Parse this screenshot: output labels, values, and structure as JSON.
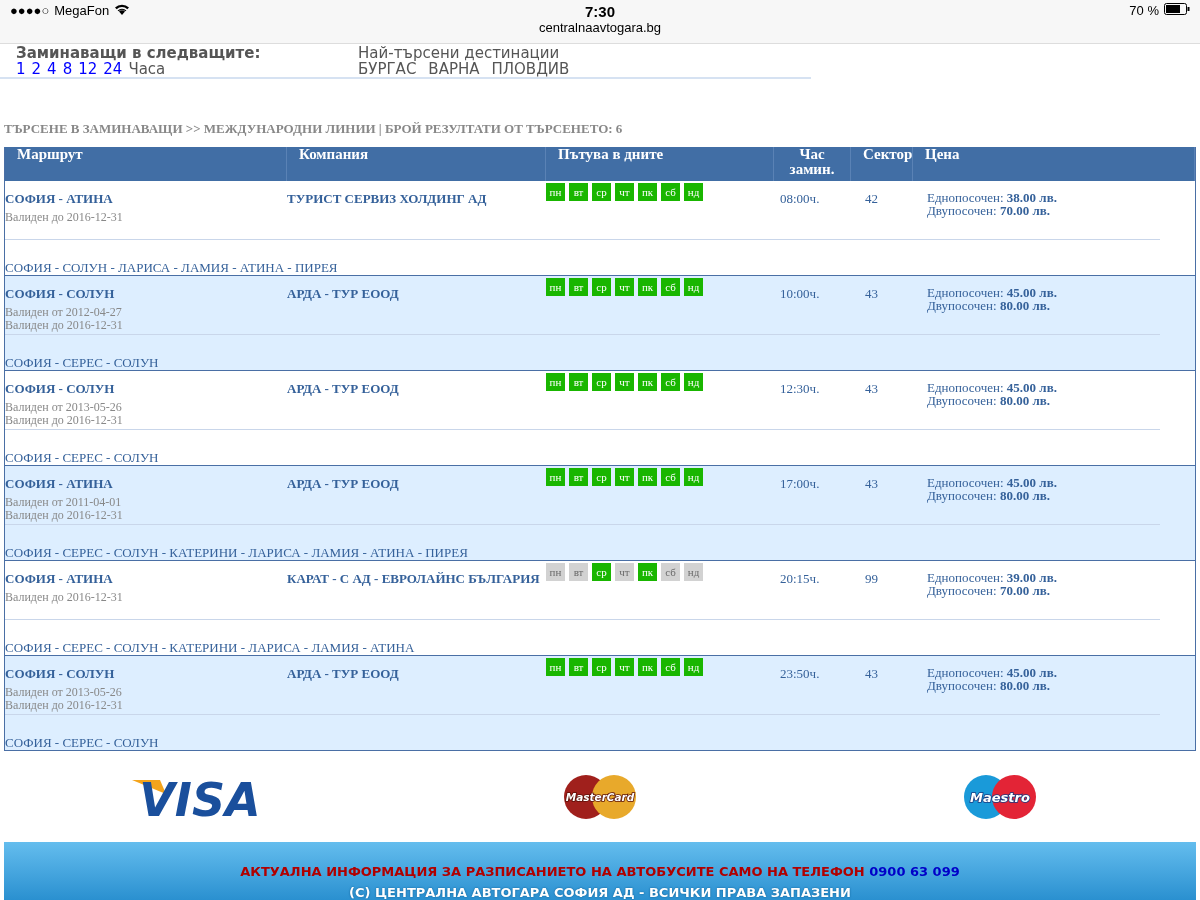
{
  "status_bar": {
    "signal": "●●●●○",
    "carrier": "MegaFon",
    "time": "7:30",
    "url": "centralnaavtogara.bg",
    "battery": "70 %"
  },
  "departures": {
    "label": "Заминаващи в следващите:",
    "hours": [
      "1",
      "2",
      "4",
      "8",
      "12",
      "24"
    ],
    "unit": "Часа"
  },
  "popular": {
    "label": "Най-търсени дестинации",
    "items": [
      "БУРГАС",
      "ВАРНА",
      "ПЛОВДИВ"
    ]
  },
  "results_title": "ТЪРСЕНЕ В ЗАМИНАВАЩИ >> МЕЖДУНАРОДНИ ЛИНИИ | БРОЙ РЕЗУЛТАТИ ОТ ТЪРСЕНЕТО: 6",
  "table": {
    "columns": [
      "Маршрут",
      "Компания",
      "Пътува в дните",
      "Час замин.",
      "Сектор",
      "Цена"
    ],
    "rows": [
      {
        "route": "СОФИЯ - АТИНА",
        "validity": [
          "Валиден до 2016-12-31"
        ],
        "company": "ТУРИСТ СЕРВИЗ ХОЛДИНГ АД",
        "days": [
          {
            "label": "пн",
            "on": true
          },
          {
            "label": "вт",
            "on": true
          },
          {
            "label": "ср",
            "on": true
          },
          {
            "label": "чт",
            "on": true
          },
          {
            "label": "пк",
            "on": true
          },
          {
            "label": "сб",
            "on": true
          },
          {
            "label": "нд",
            "on": true
          }
        ],
        "time": "08:00ч.",
        "sector": "42",
        "one_way_label": "Еднопосочен:",
        "one_way": "38.00 лв.",
        "return_label": "Двупосочен:",
        "return": "70.00 лв.",
        "stops": "СОФИЯ - СОЛУН - ЛАРИСА - ЛАМИЯ - АТИНА - ПИРЕЯ"
      },
      {
        "route": "СОФИЯ - СОЛУН",
        "validity": [
          "Валиден от 2012-04-27",
          "Валиден до 2016-12-31"
        ],
        "company": "АРДА - ТУР ЕООД",
        "days": [
          {
            "label": "пн",
            "on": true
          },
          {
            "label": "вт",
            "on": true
          },
          {
            "label": "ср",
            "on": true
          },
          {
            "label": "чт",
            "on": true
          },
          {
            "label": "пк",
            "on": true
          },
          {
            "label": "сб",
            "on": true
          },
          {
            "label": "нд",
            "on": true
          }
        ],
        "time": "10:00ч.",
        "sector": "43",
        "one_way_label": "Еднопосочен:",
        "one_way": "45.00 лв.",
        "return_label": "Двупосочен:",
        "return": "80.00 лв.",
        "stops": "СОФИЯ - СЕРЕС - СОЛУН"
      },
      {
        "route": "СОФИЯ - СОЛУН",
        "validity": [
          "Валиден от 2013-05-26",
          "Валиден до 2016-12-31"
        ],
        "company": "АРДА - ТУР ЕООД",
        "days": [
          {
            "label": "пн",
            "on": true
          },
          {
            "label": "вт",
            "on": true
          },
          {
            "label": "ср",
            "on": true
          },
          {
            "label": "чт",
            "on": true
          },
          {
            "label": "пк",
            "on": true
          },
          {
            "label": "сб",
            "on": true
          },
          {
            "label": "нд",
            "on": true
          }
        ],
        "time": "12:30ч.",
        "sector": "43",
        "one_way_label": "Еднопосочен:",
        "one_way": "45.00 лв.",
        "return_label": "Двупосочен:",
        "return": "80.00 лв.",
        "stops": "СОФИЯ - СЕРЕС - СОЛУН"
      },
      {
        "route": "СОФИЯ - АТИНА",
        "validity": [
          "Валиден от 2011-04-01",
          "Валиден до 2016-12-31"
        ],
        "company": "АРДА - ТУР ЕООД",
        "days": [
          {
            "label": "пн",
            "on": true
          },
          {
            "label": "вт",
            "on": true
          },
          {
            "label": "ср",
            "on": true
          },
          {
            "label": "чт",
            "on": true
          },
          {
            "label": "пк",
            "on": true
          },
          {
            "label": "сб",
            "on": true
          },
          {
            "label": "нд",
            "on": true
          }
        ],
        "time": "17:00ч.",
        "sector": "43",
        "one_way_label": "Еднопосочен:",
        "one_way": "45.00 лв.",
        "return_label": "Двупосочен:",
        "return": "80.00 лв.",
        "stops": "СОФИЯ - СЕРЕС - СОЛУН - КАТЕРИНИ - ЛАРИСА - ЛАМИЯ - АТИНА - ПИРЕЯ"
      },
      {
        "route": "СОФИЯ - АТИНА",
        "validity": [
          "Валиден до 2016-12-31"
        ],
        "company": "КАРАТ - С АД - ЕВРОЛАЙНС БЪЛГАРИЯ",
        "days": [
          {
            "label": "пн",
            "on": false
          },
          {
            "label": "вт",
            "on": false
          },
          {
            "label": "ср",
            "on": true
          },
          {
            "label": "чт",
            "on": false
          },
          {
            "label": "пк",
            "on": true
          },
          {
            "label": "сб",
            "on": false
          },
          {
            "label": "нд",
            "on": false
          }
        ],
        "time": "20:15ч.",
        "sector": "99",
        "one_way_label": "Еднопосочен:",
        "one_way": "39.00 лв.",
        "return_label": "Двупосочен:",
        "return": "70.00 лв.",
        "stops": "СОФИЯ - СЕРЕС - СОЛУН - КАТЕРИНИ - ЛАРИСА - ЛАМИЯ - АТИНА"
      },
      {
        "route": "СОФИЯ - СОЛУН",
        "validity": [
          "Валиден от 2013-05-26",
          "Валиден до 2016-12-31"
        ],
        "company": "АРДА - ТУР ЕООД",
        "days": [
          {
            "label": "пн",
            "on": true
          },
          {
            "label": "вт",
            "on": true
          },
          {
            "label": "ср",
            "on": true
          },
          {
            "label": "чт",
            "on": true
          },
          {
            "label": "пк",
            "on": true
          },
          {
            "label": "сб",
            "on": true
          },
          {
            "label": "нд",
            "on": true
          }
        ],
        "time": "23:50ч.",
        "sector": "43",
        "one_way_label": "Еднопосочен:",
        "one_way": "45.00 лв.",
        "return_label": "Двупосочен:",
        "return": "80.00 лв.",
        "stops": "СОФИЯ - СЕРЕС - СОЛУН"
      }
    ]
  },
  "payment_logos": [
    {
      "kind": "visa",
      "text": "VISA"
    },
    {
      "kind": "mastercard",
      "text": "MasterCard"
    },
    {
      "kind": "maestro",
      "text": "Maestro"
    }
  ],
  "footer": {
    "notice": "АКТУАЛНА ИНФОРМАЦИЯ ЗА РАЗПИСАНИЕТО НА АВТОБУСИТЕ САМО НА ТЕЛЕФОН",
    "phone": "0900 63 099",
    "copyright": "(C) ЦЕНТРАЛНА АВТОГАРА СОФИЯ АД - ВСИЧКИ ПРАВА ЗАПАЗЕНИ"
  }
}
